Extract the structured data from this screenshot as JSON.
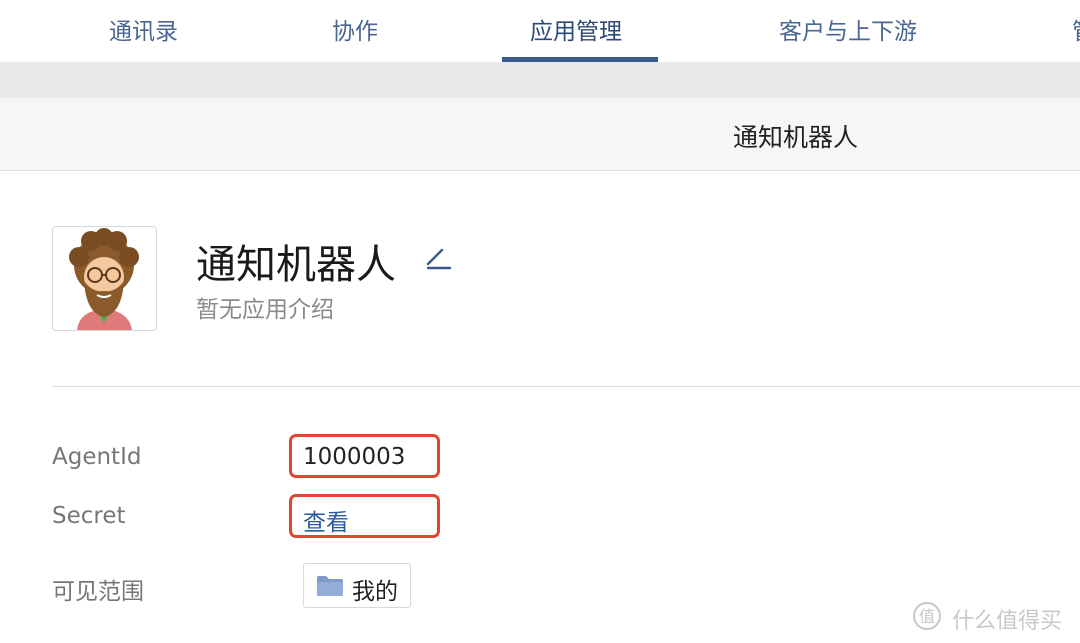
{
  "nav": {
    "tabs": [
      {
        "label": "通讯录"
      },
      {
        "label": "协作"
      },
      {
        "label": "应用管理"
      },
      {
        "label": "客户与上下游"
      },
      {
        "label": "管"
      }
    ],
    "active_tab": "应用管理"
  },
  "subheader": {
    "title": "通知机器人"
  },
  "app": {
    "name": "通知机器人",
    "description": "暂无应用介绍",
    "avatar_icon": "bearded-man-avatar",
    "edit_icon": "pencil-icon"
  },
  "fields": {
    "agentid": {
      "label": "AgentId",
      "value": "1000003"
    },
    "secret": {
      "label": "Secret",
      "link": "查看"
    },
    "scope": {
      "label": "可见范围",
      "value": "我的",
      "icon": "folder-icon"
    }
  },
  "watermark": {
    "text": "什么值得买",
    "icon": "zhi-icon"
  },
  "colors": {
    "accent": "#3a5a8c",
    "highlight_box": "#e0452f",
    "link": "#2b5aa0"
  }
}
